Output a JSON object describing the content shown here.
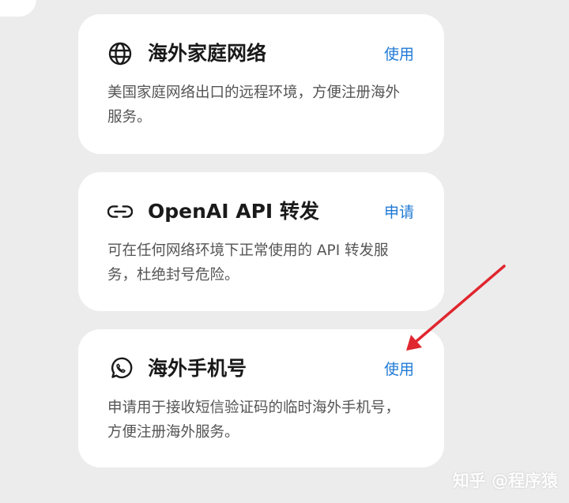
{
  "cards": [
    {
      "icon": "globe-icon",
      "title": "海外家庭网络",
      "action": "使用",
      "description": "美国家庭网络出口的远程环境，方便注册海外服务。"
    },
    {
      "icon": "link-icon",
      "title": "OpenAI API 转发",
      "action": "申请",
      "description": "可在任何网络环境下正常使用的 API 转发服务，杜绝封号危险。"
    },
    {
      "icon": "whatsapp-icon",
      "title": "海外手机号",
      "action": "使用",
      "description": "申请用于接收短信验证码的临时海外手机号，方便注册海外服务。"
    }
  ],
  "watermark": "知乎 @程序猿",
  "colors": {
    "accent": "#1f7ad6",
    "arrow": "#e0262f",
    "background": "#ececec"
  }
}
